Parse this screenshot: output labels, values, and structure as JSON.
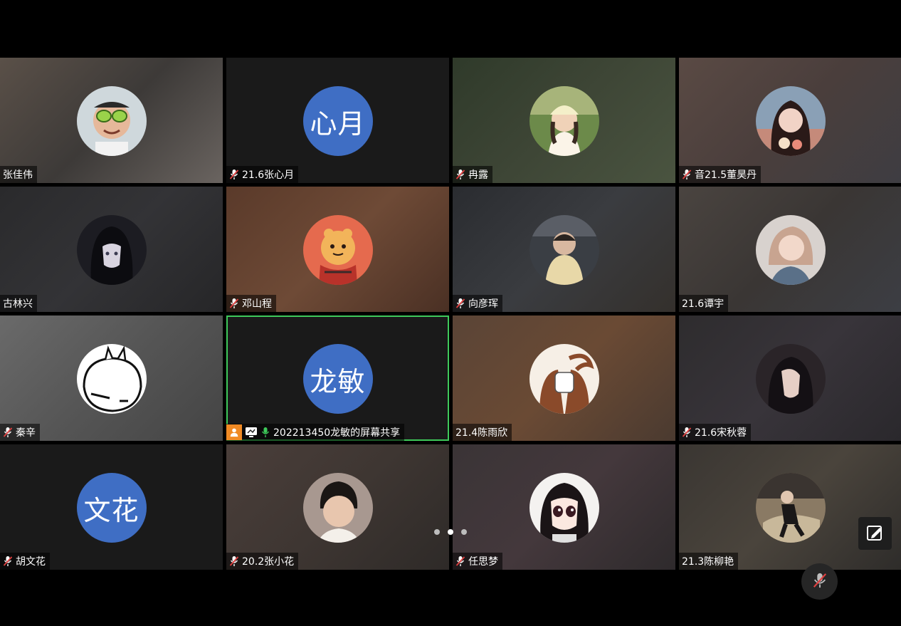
{
  "participants": [
    {
      "name": "张佳伟",
      "muted": false,
      "avatar_type": "photo"
    },
    {
      "name": "21.6张心月",
      "muted": true,
      "avatar_type": "initials",
      "initials": "心月"
    },
    {
      "name": "冉露",
      "muted": true,
      "avatar_type": "photo"
    },
    {
      "name": "音21.5董昊丹",
      "muted": true,
      "avatar_type": "photo"
    },
    {
      "name": "古林兴",
      "muted": false,
      "avatar_type": "photo"
    },
    {
      "name": "邓山程",
      "muted": true,
      "avatar_type": "photo"
    },
    {
      "name": "向彦珲",
      "muted": true,
      "avatar_type": "photo"
    },
    {
      "name": "21.6谭宇",
      "muted": false,
      "avatar_type": "photo"
    },
    {
      "name": "秦辛",
      "muted": true,
      "avatar_type": "photo"
    },
    {
      "name": "202213450龙敏的屏幕共享",
      "muted": false,
      "mic_active": true,
      "avatar_type": "initials",
      "initials": "龙敏",
      "active_speaker": true,
      "screen_sharing": true
    },
    {
      "name": "21.4陈雨欣",
      "muted": false,
      "avatar_type": "photo"
    },
    {
      "name": "21.6宋秋蓉",
      "muted": true,
      "avatar_type": "photo"
    },
    {
      "name": "胡文花",
      "muted": true,
      "avatar_type": "initials",
      "initials": "文花"
    },
    {
      "name": "20.2张小花",
      "muted": true,
      "avatar_type": "photo"
    },
    {
      "name": "任思梦",
      "muted": true,
      "avatar_type": "photo"
    },
    {
      "name": "21.3陈柳艳",
      "muted": false,
      "avatar_type": "photo"
    }
  ],
  "pagination": {
    "pages": 3,
    "current": 2
  },
  "controls": {
    "edit_icon": "annotate-icon",
    "mute_icon": "mic-muted-icon"
  },
  "colors": {
    "initials_bg": "#3f6ec4",
    "active_border": "#3ec95a",
    "share_badge": "#f08a24",
    "muted_red": "#e04040"
  }
}
